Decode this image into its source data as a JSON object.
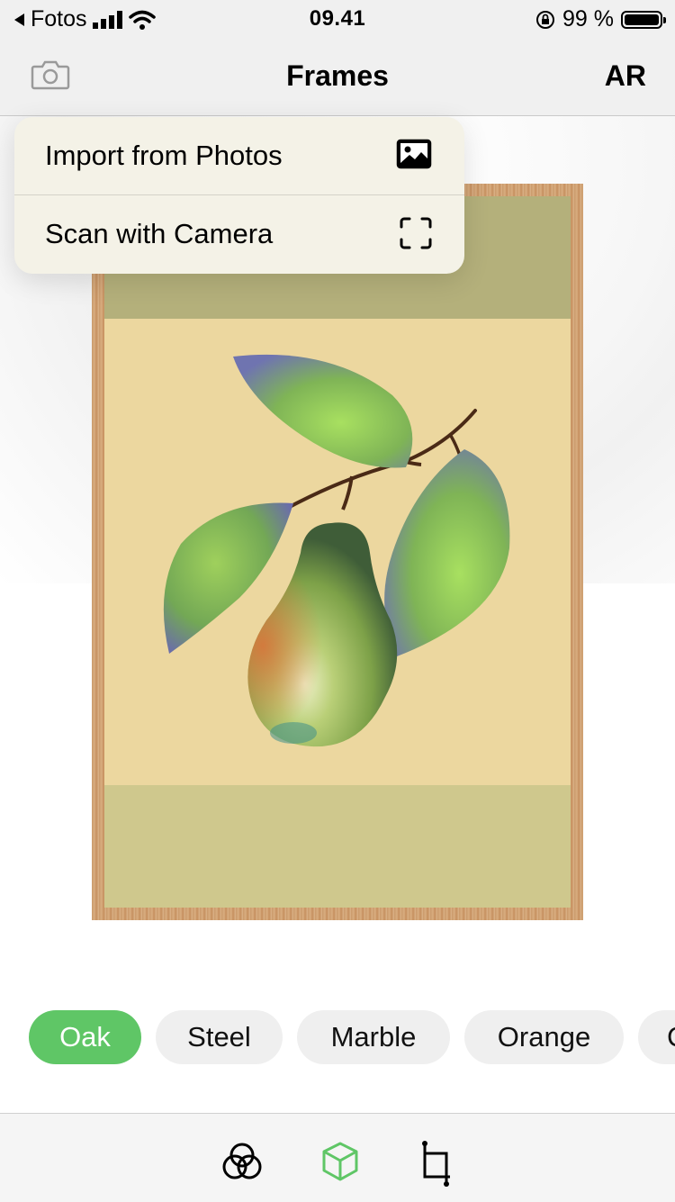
{
  "status_bar": {
    "back_label": "Fotos",
    "time": "09.41",
    "battery": "99 %"
  },
  "nav": {
    "title": "Frames",
    "right_label": "AR",
    "left_icon": "camera-icon"
  },
  "menu": {
    "items": [
      {
        "label": "Import from Photos",
        "icon": "photo-icon"
      },
      {
        "label": "Scan with Camera",
        "icon": "scan-icon"
      }
    ]
  },
  "artwork": {
    "frame_material": "Oak",
    "subject": "pear-illustration"
  },
  "frame_options": {
    "items": [
      "Oak",
      "Steel",
      "Marble",
      "Orange",
      "C"
    ],
    "selected": "Oak",
    "accent": "#5fc666"
  },
  "tab_bar": {
    "tabs": [
      {
        "icon": "filters-icon",
        "active": false
      },
      {
        "icon": "cube-icon",
        "active": true
      },
      {
        "icon": "crop-icon",
        "active": false
      }
    ]
  }
}
